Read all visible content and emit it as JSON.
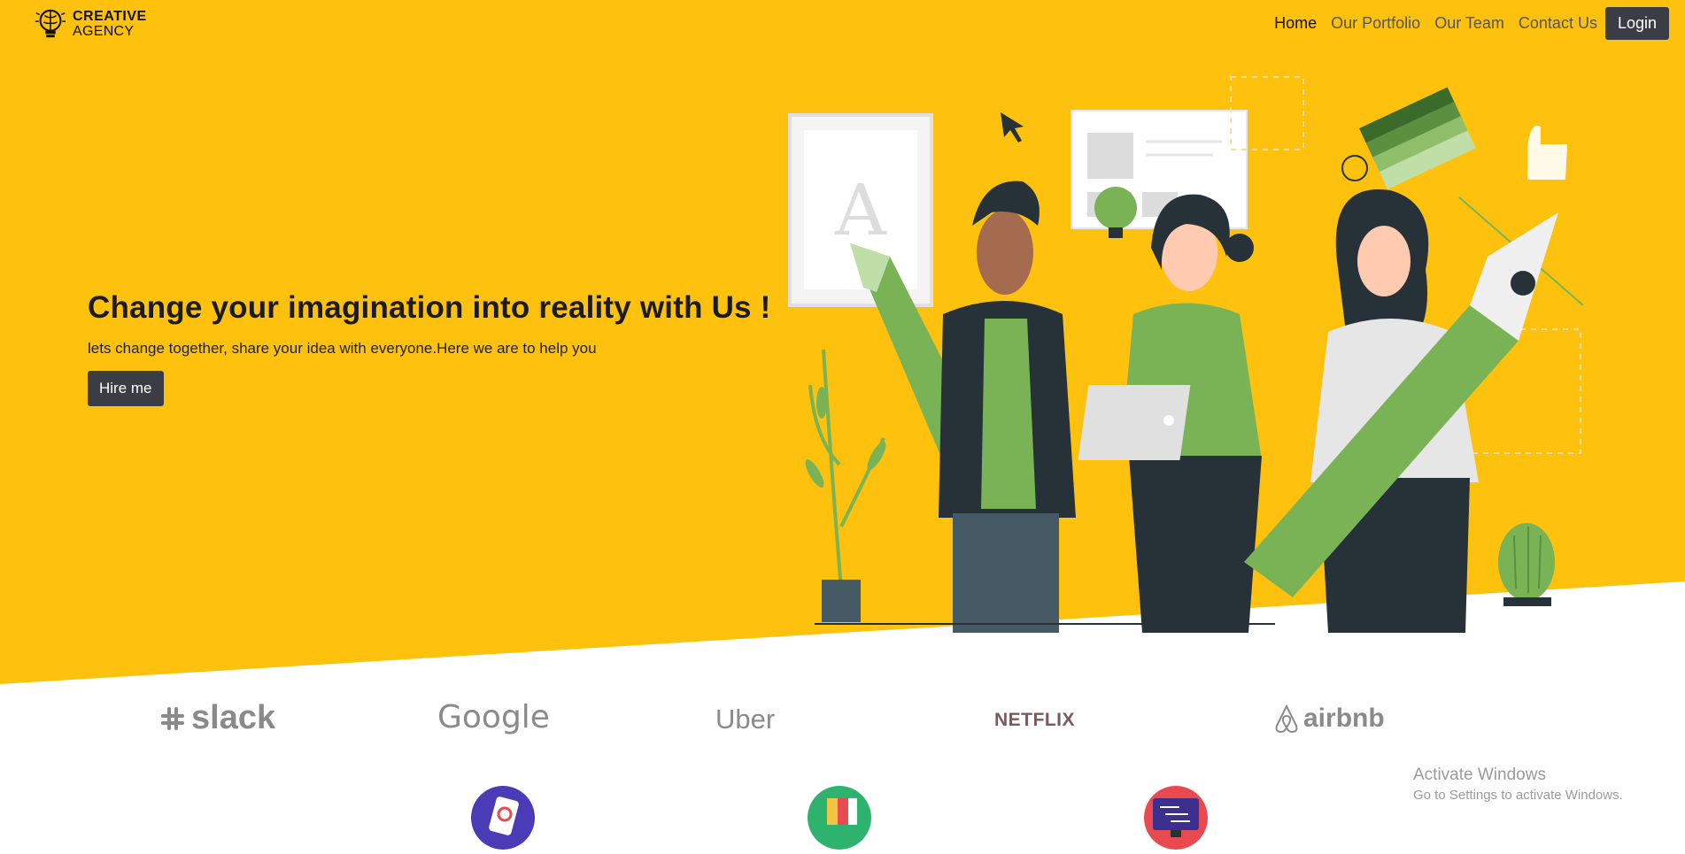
{
  "brand": {
    "line1": "CREATIVE",
    "line2": "AGENCY",
    "icon": "lightbulb-brain-icon"
  },
  "nav": {
    "items": [
      {
        "label": "Home",
        "active": true
      },
      {
        "label": "Our Portfolio",
        "active": false
      },
      {
        "label": "Our Team",
        "active": false
      },
      {
        "label": "Contact Us",
        "active": false
      }
    ],
    "login_label": "Login"
  },
  "hero": {
    "title": "Change your imagination into reality with Us !",
    "subtitle": "lets change together, share your idea with everyone.Here we are to help you",
    "cta_label": "Hire me",
    "illustration": "team-creative-illustration"
  },
  "clients": {
    "logos": [
      {
        "name": "slack",
        "icon": "slack-logo-icon"
      },
      {
        "name": "Google",
        "icon": "google-logo-icon"
      },
      {
        "name": "Uber",
        "icon": "uber-logo-icon"
      },
      {
        "name": "NETFLIX",
        "icon": "netflix-logo-icon"
      },
      {
        "name": "airbnb",
        "icon": "airbnb-logo-icon"
      }
    ]
  },
  "services": {
    "icons": [
      "mobile-app-icon",
      "color-palette-icon",
      "code-monitor-icon"
    ]
  },
  "os_overlay": {
    "title": "Activate Windows",
    "subtitle": "Go to Settings to activate Windows."
  },
  "colors": {
    "hero_bg": "#fec20e",
    "button_dark": "#3a3d43",
    "illustration_green": "#7ab356",
    "illustration_dark": "#263238"
  }
}
